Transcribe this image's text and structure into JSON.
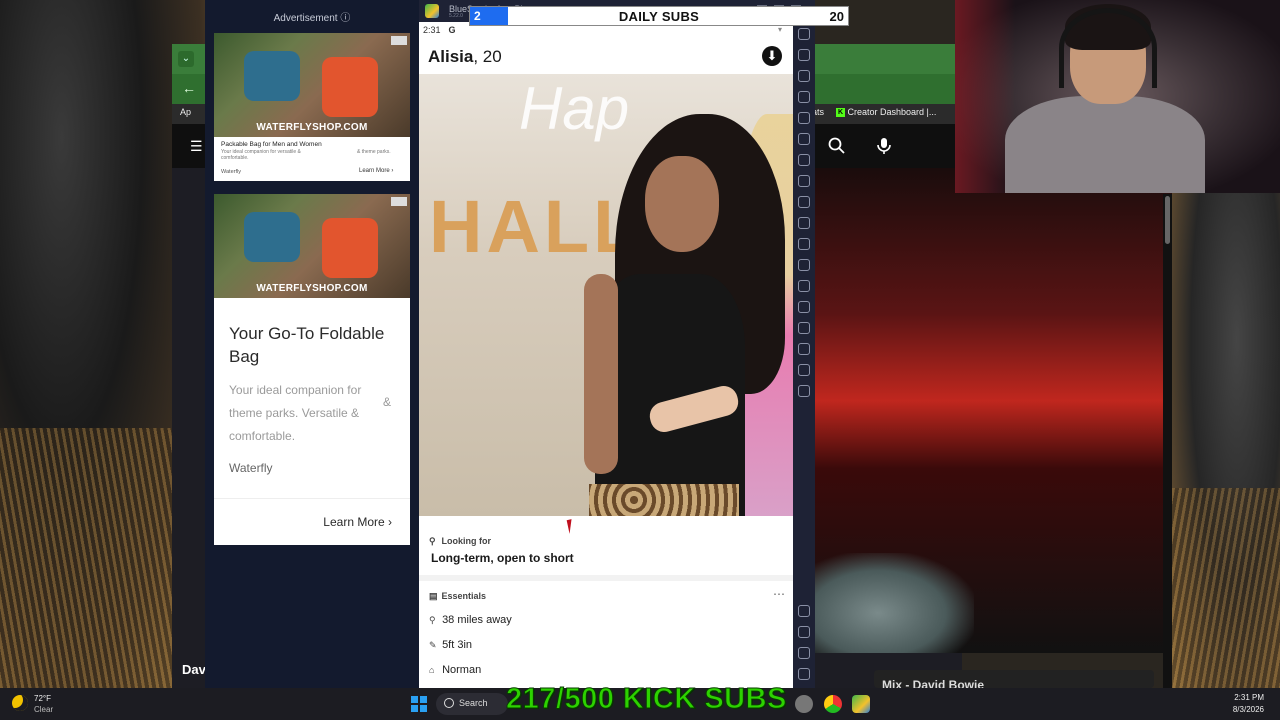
{
  "ad_panel": {
    "label": "Advertisement ⓘ",
    "banner_brand": "WATERFLYSHOP.COM",
    "small_title": "Packable Bag for Men and Women",
    "small_desc": "Your ideal companion for versatile & comfortable.",
    "small_desc2": "& theme parks.",
    "small_brand": "Waterfly",
    "small_cta": "Learn More ›",
    "headline": "Your Go-To Foldable Bag",
    "body": "Your ideal companion for theme parks. Versatile & comfortable.",
    "amp": "&",
    "brand": "Waterfly",
    "cta": "Learn More ›"
  },
  "emulator": {
    "title": "BlueStacks App Player",
    "subtitle": "5.22.0"
  },
  "subs_overlay": {
    "current": "2",
    "label": "DAILY SUBS",
    "goal": "20",
    "progress": 0.1
  },
  "profile": {
    "status_time": "2:31",
    "status_g": "G",
    "name": "Alisia",
    "age": ", 20",
    "more_button": "⬇",
    "looking_for_label": "Looking for",
    "looking_for_value": "Long-term, open to short",
    "essentials_label": "Essentials",
    "essentials_more": "⋯",
    "essentials": [
      {
        "icon": "location-pin-icon",
        "text": "38 miles away"
      },
      {
        "icon": "ruler-icon",
        "text": "5ft 3in"
      },
      {
        "icon": "home-icon",
        "text": "Norman"
      }
    ],
    "photo_wall_text": "HALL",
    "photo_script_text": "Hap"
  },
  "browser": {
    "bookmark_1": "Ap",
    "bookmark_2": "ats",
    "bookmark_3": "Creator Dashboard |...",
    "left_title": "Dav",
    "right_title": "Mix - David Bowie"
  },
  "stream_overlay": {
    "kick_subs": "217/500 KICK SUBS"
  },
  "taskbar": {
    "temperature": "72°F",
    "condition": "Clear",
    "search": "Search",
    "time": "2:31 PM",
    "date": "8/3/2026"
  },
  "colors": {
    "subs_fill": "#1e6cf0",
    "kick_green": "#2dd200",
    "browser_theme": "#3a7d3a"
  }
}
